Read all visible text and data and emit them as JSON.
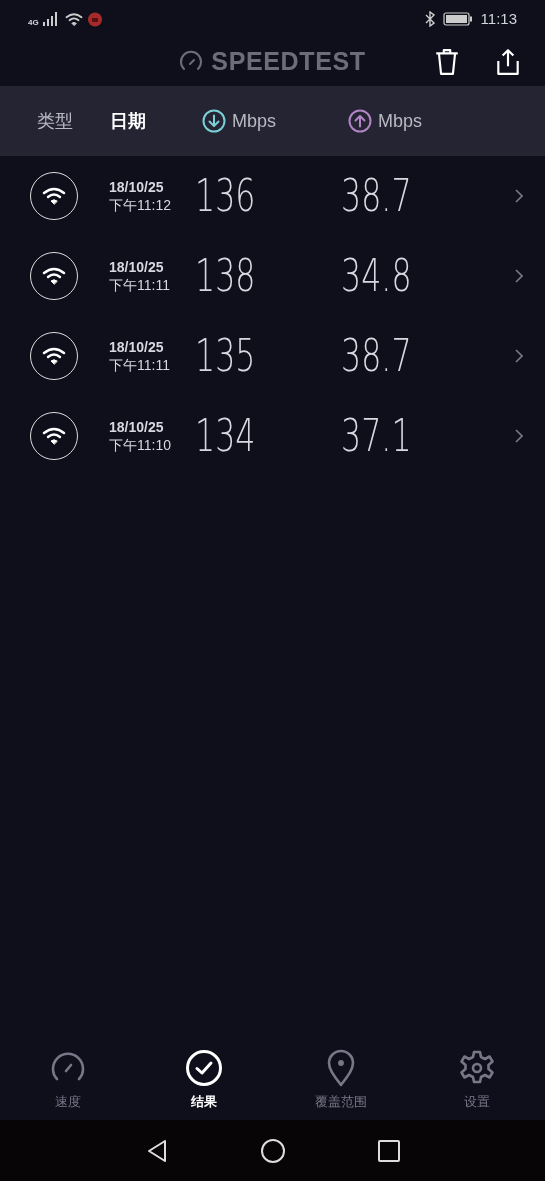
{
  "status_bar": {
    "network": "4G",
    "time": "11:13"
  },
  "app_bar": {
    "title": "SPEEDTEST"
  },
  "columns": [
    {
      "kind": "text",
      "label": "类型",
      "selected": false
    },
    {
      "kind": "text",
      "label": "日期",
      "selected": true
    },
    {
      "kind": "download",
      "label": "Mbps",
      "selected": false
    },
    {
      "kind": "upload",
      "label": "Mbps",
      "selected": false
    }
  ],
  "results": [
    {
      "date": "18/10/25",
      "time": "下午11:12",
      "download": "136",
      "upload": "38.7"
    },
    {
      "date": "18/10/25",
      "time": "下午11:11",
      "download": "138",
      "upload": "34.8"
    },
    {
      "date": "18/10/25",
      "time": "下午11:11",
      "download": "135",
      "upload": "38.7"
    },
    {
      "date": "18/10/25",
      "time": "下午11:10",
      "download": "134",
      "upload": "37.1"
    }
  ],
  "nav": [
    {
      "kind": "speed",
      "label": "速度",
      "selected": false
    },
    {
      "kind": "results",
      "label": "结果",
      "selected": true
    },
    {
      "kind": "coverage",
      "label": "覆盖范围",
      "selected": false
    },
    {
      "kind": "settings",
      "label": "设置",
      "selected": false
    }
  ]
}
